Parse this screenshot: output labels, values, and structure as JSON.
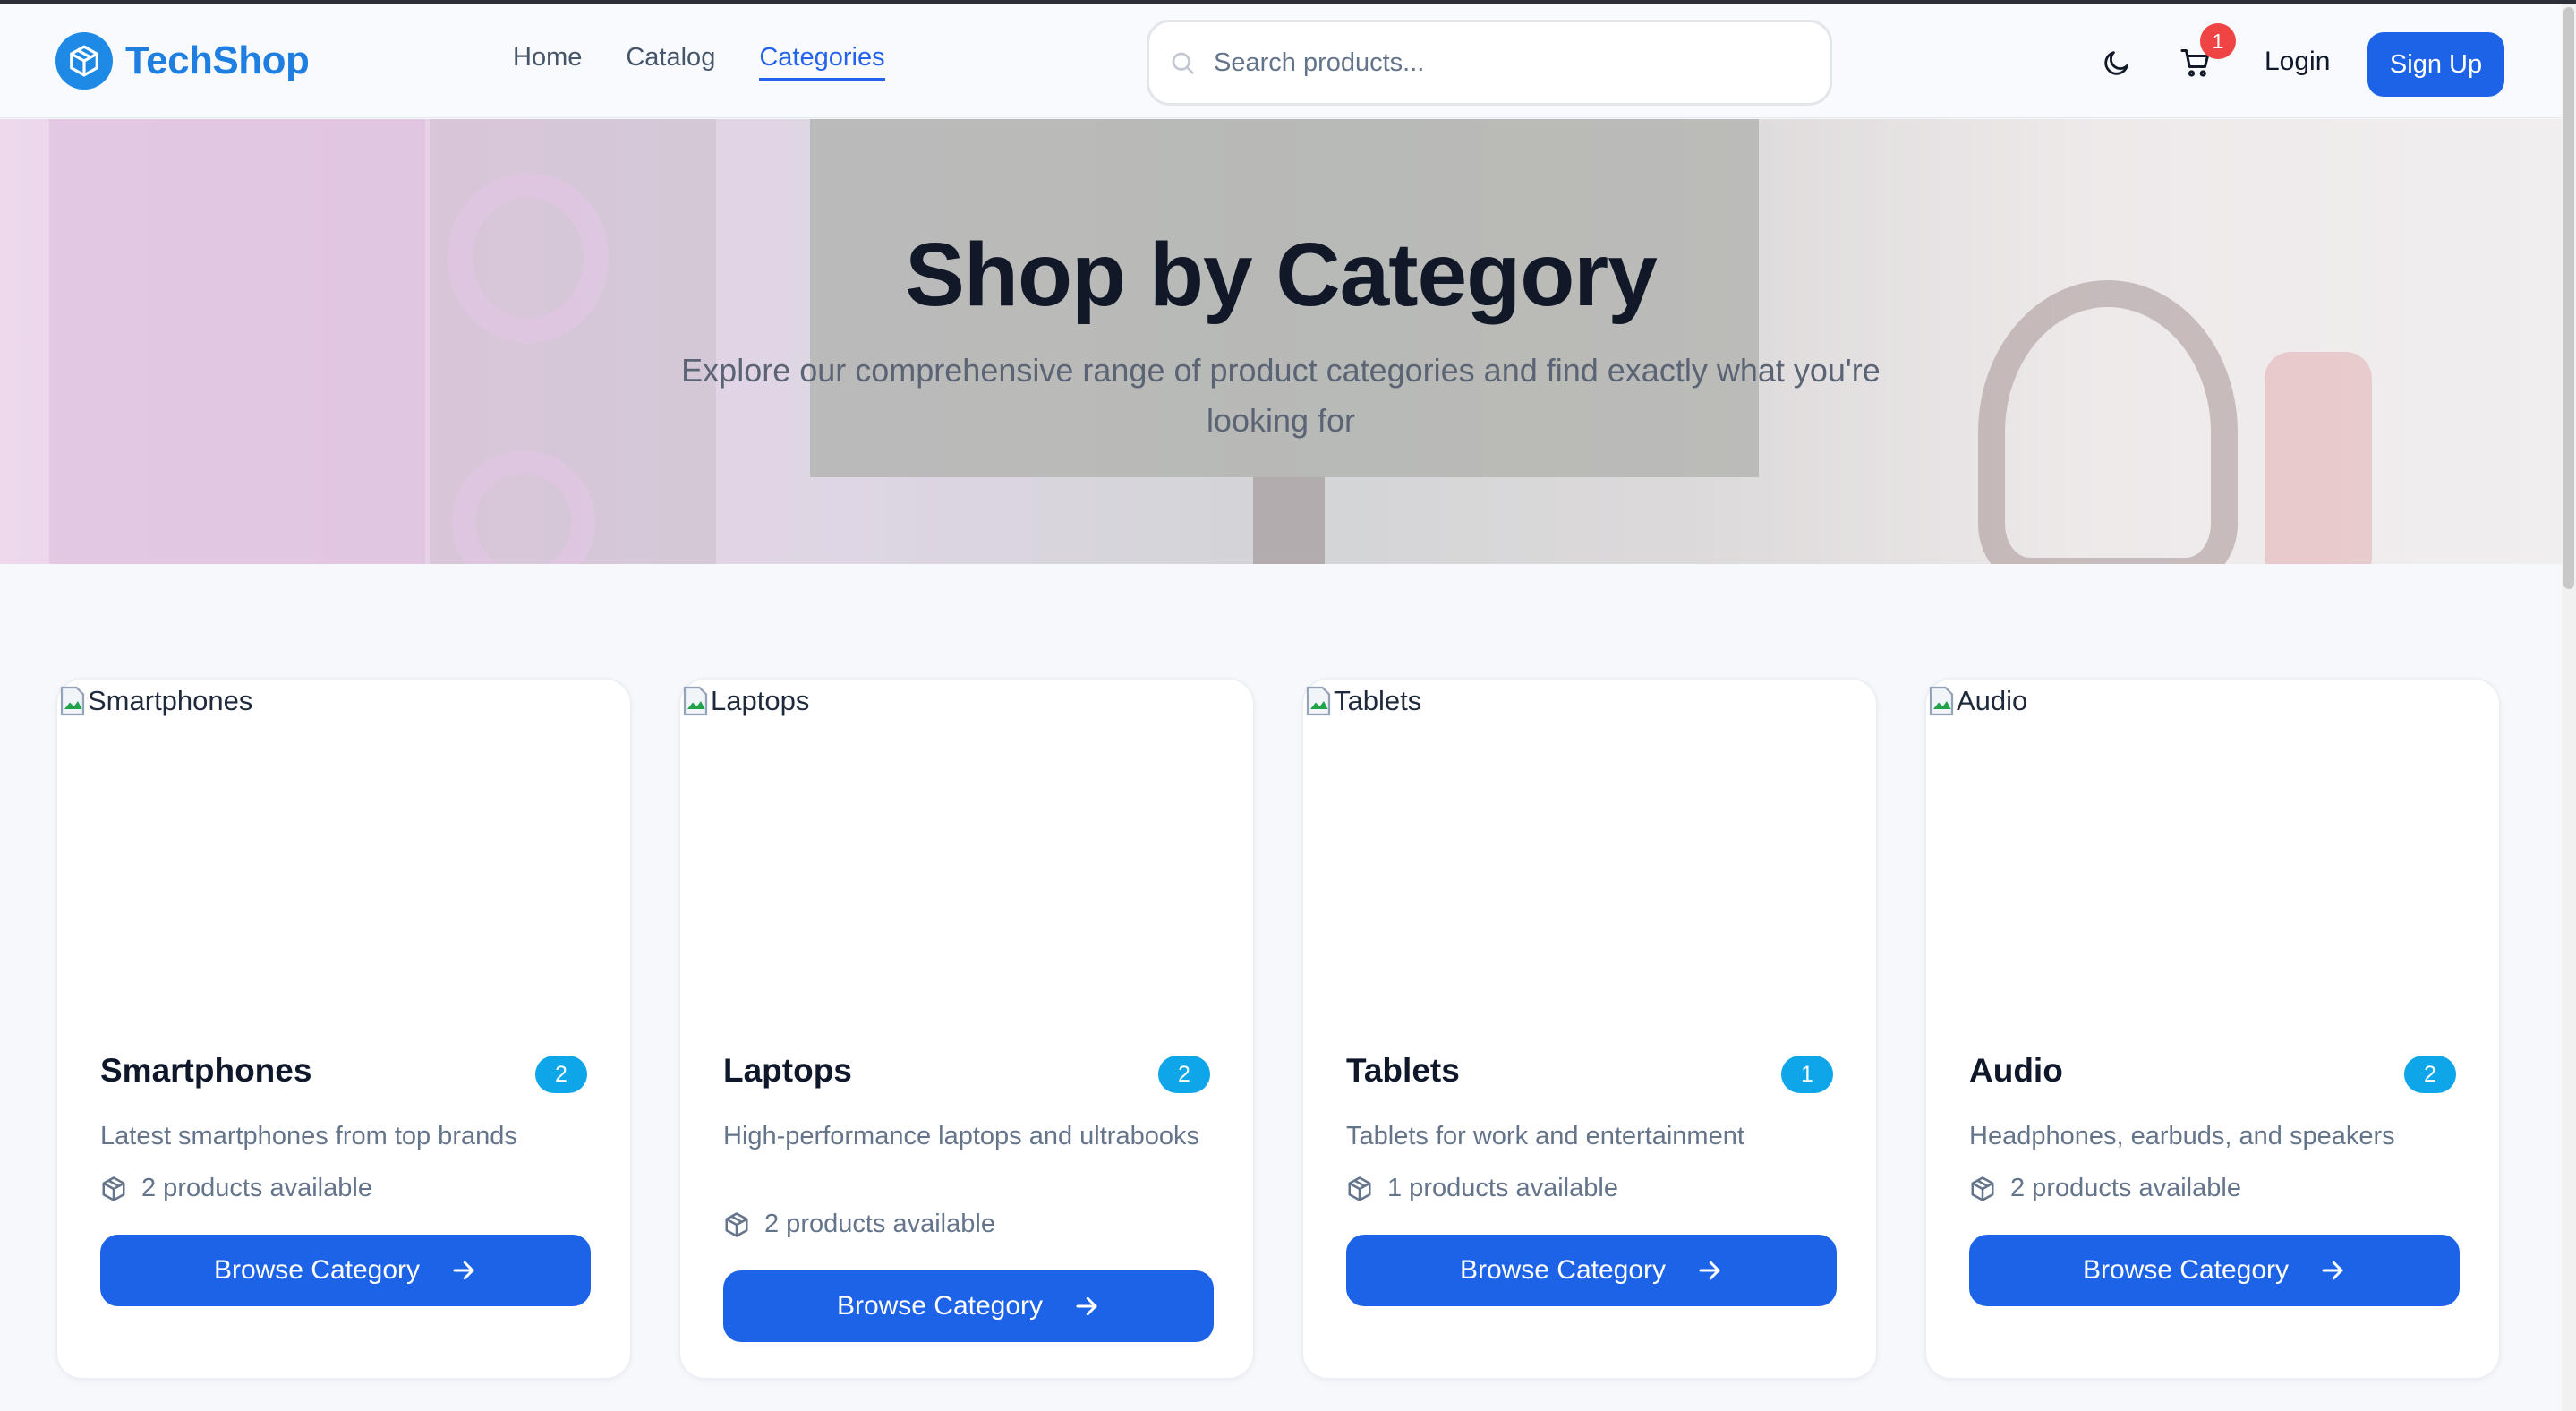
{
  "brand": {
    "name": "TechShop",
    "accent": "#1f7fe0"
  },
  "nav": [
    {
      "label": "Home",
      "active": false
    },
    {
      "label": "Catalog",
      "active": false
    },
    {
      "label": "Categories",
      "active": true
    }
  ],
  "search": {
    "placeholder": "Search products...",
    "value": ""
  },
  "header_actions": {
    "theme_icon": "moon-icon",
    "cart_icon": "cart-icon",
    "cart_count": "1",
    "login_label": "Login",
    "signup_label": "Sign Up"
  },
  "hero": {
    "title": "Shop by Category",
    "subtitle": "Explore our comprehensive range of product categories and find exactly what you're looking for"
  },
  "categories": [
    {
      "image_alt": "Smartphones",
      "name": "Smartphones",
      "count": "2",
      "description": "Latest smartphones from top brands",
      "available": "2 products available",
      "button_label": "Browse Category"
    },
    {
      "image_alt": "Laptops",
      "name": "Laptops",
      "count": "2",
      "description": "High-performance laptops and ultrabooks",
      "available": "2 products available",
      "button_label": "Browse Category"
    },
    {
      "image_alt": "Tablets",
      "name": "Tablets",
      "count": "1",
      "description": "Tablets for work and entertainment",
      "available": "1 products available",
      "button_label": "Browse Category"
    },
    {
      "image_alt": "Audio",
      "name": "Audio",
      "count": "2",
      "description": "Headphones, earbuds, and speakers",
      "available": "2 products available",
      "button_label": "Browse Category"
    }
  ],
  "colors": {
    "primary_button": "#1d63e8",
    "badge": "#0ea5e9",
    "cart_badge": "#ef4444"
  }
}
